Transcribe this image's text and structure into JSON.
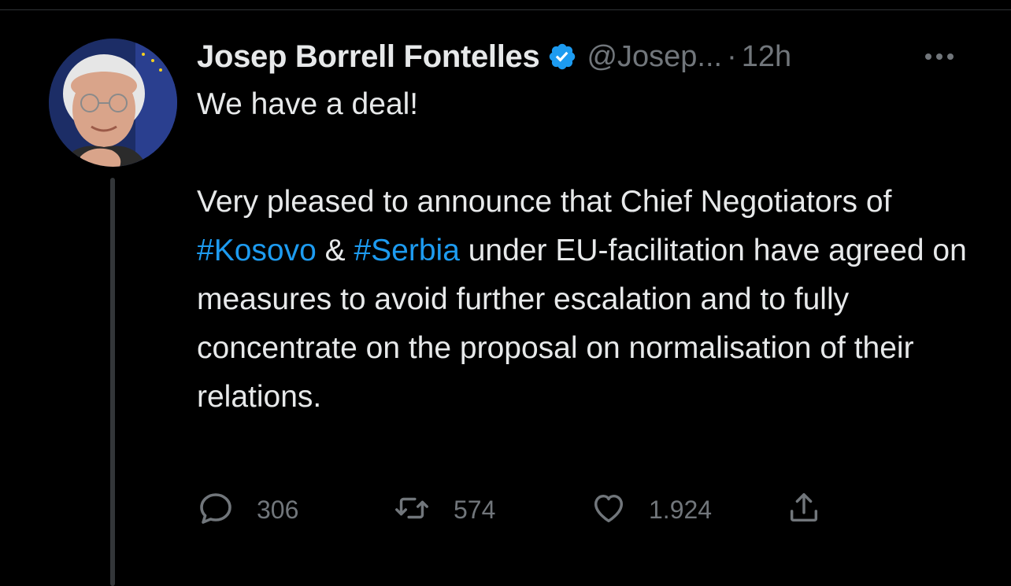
{
  "tweet": {
    "author": {
      "display_name": "Josep Borrell Fontelles",
      "handle": "@Josep...",
      "verified": true
    },
    "separator": "·",
    "time": "12h",
    "text": {
      "line1": "We have a deal!",
      "p2_part1": "Very pleased to announce that Chief Negotiators of ",
      "hashtag1": "#Kosovo",
      "p2_part2": " & ",
      "hashtag2": "#Serbia",
      "p2_part3": " under EU-facilitation have agreed on measures to avoid further escalation and to fully concentrate on the proposal on normalisation of their relations."
    },
    "stats": {
      "replies": "306",
      "retweets": "574",
      "likes": "1.924"
    }
  },
  "colors": {
    "background": "#000000",
    "text": "#e7e9ea",
    "muted": "#71767b",
    "link": "#1d9bf0",
    "verified_badge": "#1d9bf0"
  },
  "icons": {
    "verified": "verified-badge-icon",
    "more": "more-icon",
    "reply": "reply-icon",
    "retweet": "retweet-icon",
    "like": "like-icon",
    "share": "share-icon"
  }
}
